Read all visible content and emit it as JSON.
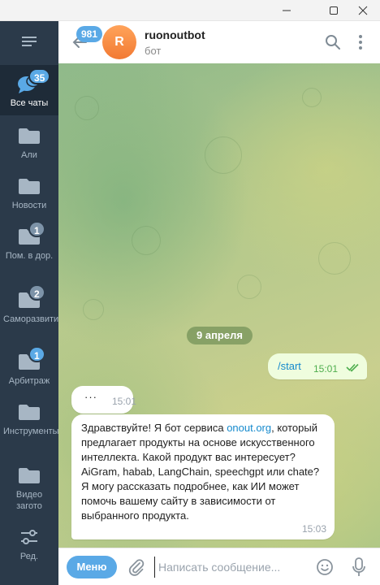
{
  "window": {
    "controls": [
      "minimize-icon",
      "maximize-icon",
      "close-icon"
    ]
  },
  "sidebar": {
    "menu_icon": "hamburger-icon",
    "folders": [
      {
        "label": "Все чаты",
        "badge": "35",
        "icon": "chat-bubbles-icon",
        "active": true
      },
      {
        "label": "Али",
        "badge": "",
        "icon": "folder-icon"
      },
      {
        "label": "Новости",
        "badge": "",
        "icon": "folder-icon"
      },
      {
        "label": "Пом. в дор.",
        "badge": "1",
        "icon": "folder-icon"
      },
      {
        "label": "Саморазвитие",
        "badge": "2",
        "icon": "folder-icon"
      },
      {
        "label": "Арбитраж",
        "badge": "1",
        "icon": "folder-icon"
      },
      {
        "label": "Инструменты",
        "badge": "",
        "icon": "folder-icon"
      },
      {
        "label": "Видео загото",
        "badge": "",
        "icon": "folder-icon"
      },
      {
        "label": "Ред.",
        "badge": "",
        "icon": "sliders-icon"
      }
    ]
  },
  "header": {
    "unread_count": "981",
    "avatar_letter": "R",
    "chat_title": "ruonoutbot",
    "chat_subtitle": "бот",
    "icons": [
      "search-icon",
      "more-vertical-icon"
    ]
  },
  "chat": {
    "date_separator": "9 апреля",
    "messages": [
      {
        "direction": "out",
        "text": "/start",
        "time": "15:01",
        "status": "read"
      },
      {
        "direction": "in",
        "text": "···",
        "time": "15:01"
      },
      {
        "direction": "in",
        "text_before_link": "Здравствуйте! Я бот сервиса ",
        "link": "onout.org",
        "text_after_link": ", который предлагает продукты на основе искусственного интеллекта. Какой продукт вас интересует? AiGram, habab, LangChain, speechgpt или chate? Я могу рассказать подробнее, как ИИ может помочь вашему сайту в зависимости от выбранного продукта.",
        "time": "15:03"
      }
    ]
  },
  "composer": {
    "menu_label": "Меню",
    "placeholder": "Написать сообщение...",
    "value": "",
    "icons": [
      "paperclip-icon",
      "emoji-icon",
      "microphone-icon"
    ]
  },
  "colors": {
    "accent": "#5aa9e6",
    "sidebar": "#2b3a4a",
    "outgoing_bubble": "#effdde",
    "link": "#168acd"
  }
}
